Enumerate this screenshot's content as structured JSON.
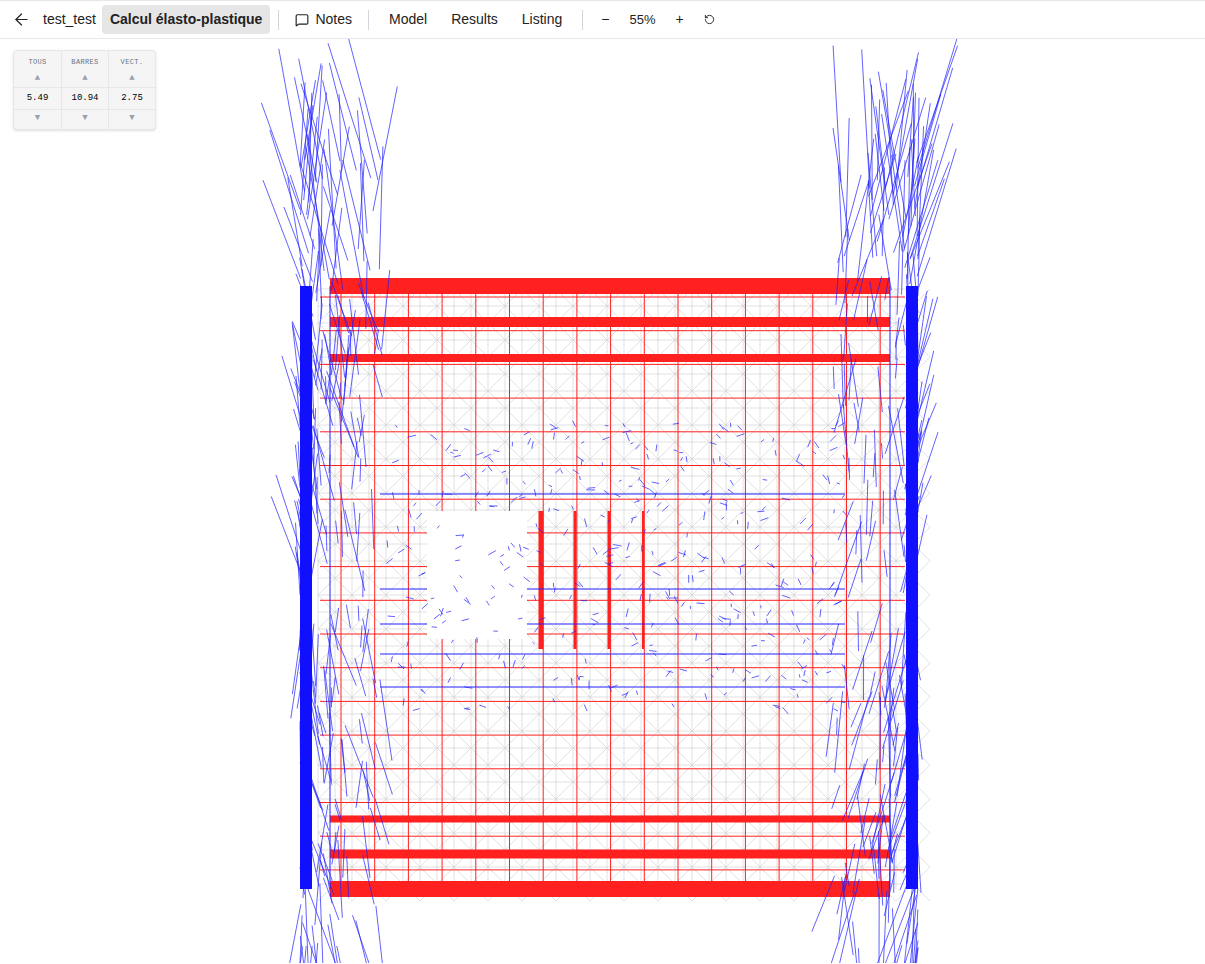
{
  "toolbar": {
    "project": "test_test",
    "tabs": [
      {
        "label": "Calcul élasto-plastique",
        "selected": true
      },
      {
        "label": "Notes",
        "selected": false
      }
    ],
    "menu": [
      {
        "label": "Model",
        "selected": false
      },
      {
        "label": "Results",
        "selected": false
      },
      {
        "label": "Listing",
        "selected": false
      }
    ],
    "zoom": {
      "minus": "−",
      "value": "55%",
      "plus": "+"
    }
  },
  "scale_panel": {
    "up": "▲",
    "down": "▼",
    "columns": [
      {
        "label": "TOUS",
        "value": "5.49"
      },
      {
        "label": "BARRES",
        "value": "10.94"
      },
      {
        "label": "VECT.",
        "value": "2.75"
      }
    ]
  }
}
